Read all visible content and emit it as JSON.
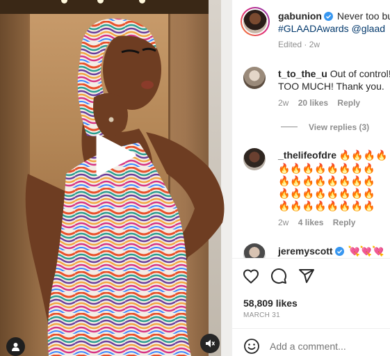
{
  "post": {
    "author": "gabunion",
    "caption_line1": "Never too bu",
    "caption_line2": "#GLAADAwards @glaad",
    "edited_label": "Edited · 2w"
  },
  "comments": [
    {
      "username": "t_to_the_u",
      "text_line1": "Out of control!",
      "text_line2": "TOO MUCH! Thank you.",
      "age": "2w",
      "likes": "20 likes",
      "reply": "Reply",
      "view_replies": "View replies (3)"
    },
    {
      "username": "_thelifeofdre",
      "emoji_line1": "🔥🔥🔥🔥",
      "emoji_lines": [
        "🔥🔥🔥🔥🔥🔥🔥🔥",
        "🔥🔥🔥🔥🔥🔥🔥🔥",
        "🔥🔥🔥🔥🔥🔥🔥🔥",
        "🔥🔥🔥🔥🔥🔥🔥🔥"
      ],
      "age": "2w",
      "likes": "4 likes",
      "reply": "Reply"
    },
    {
      "username": "jeremyscott",
      "text": "💘💘💘"
    }
  ],
  "stats": {
    "likes": "58,809 likes",
    "date": "MARCH 31"
  },
  "comment_box": {
    "placeholder": "Add a comment..."
  },
  "icons": {
    "like": "heart-icon",
    "comment": "comment-bubble-icon",
    "share": "paper-plane-icon",
    "emoji": "smiley-icon",
    "play": "play-icon",
    "profile": "user-icon",
    "mute": "muted-speaker-icon",
    "verified": "verified-badge-icon"
  },
  "colors": {
    "verified": "#3897f0",
    "text": "#262626",
    "secondary": "#8e8e8e",
    "story_ring_start": "#f58529",
    "story_ring_end": "#dd2a7b"
  }
}
